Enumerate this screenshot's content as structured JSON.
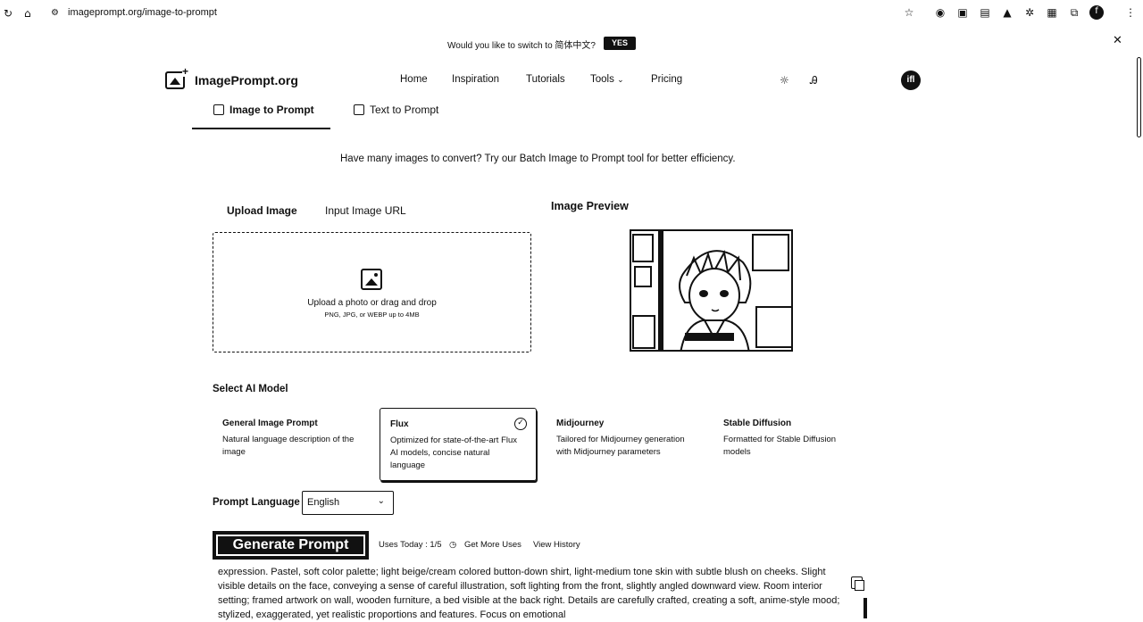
{
  "browser": {
    "url": "imageprompt.org/image-to-prompt",
    "icons": [
      "reload-icon",
      "home-icon",
      "site-info-icon",
      "bookmark-star-icon",
      "extension-icon",
      "extension-icon",
      "extension-icon",
      "extension-icon",
      "extension-icon",
      "extension-icon",
      "puzzle-icon",
      "profile-icon",
      "menu-icon"
    ]
  },
  "banner": {
    "text": "Would you like to switch to 简体中文?",
    "yes_label": "YES"
  },
  "header": {
    "logo_text": "ImagePrompt.org",
    "nav": [
      "Home",
      "Inspiration",
      "Tutorials",
      "Tools",
      "Pricing"
    ],
    "avatar_text": "ifl"
  },
  "tabs": {
    "image_to_prompt": "Image to Prompt",
    "text_to_prompt": "Text to Prompt"
  },
  "batch_text": "Have many images to convert? Try our Batch Image to Prompt tool for better efficiency.",
  "upload": {
    "tab_upload": "Upload Image",
    "tab_url": "Input Image URL",
    "drop_main": "Upload a photo or drag and drop",
    "drop_sub": "PNG, JPG, or WEBP up to 4MB"
  },
  "preview": {
    "title": "Image Preview"
  },
  "models": {
    "section_title": "Select AI Model",
    "items": [
      {
        "title": "General Image Prompt",
        "desc": "Natural language description of the image"
      },
      {
        "title": "Flux",
        "desc": "Optimized for state-of-the-art Flux AI models, concise natural language"
      },
      {
        "title": "Midjourney",
        "desc": "Tailored for Midjourney generation with Midjourney parameters"
      },
      {
        "title": "Stable Diffusion",
        "desc": "Formatted for Stable Diffusion models"
      }
    ],
    "selected": "Flux"
  },
  "prompt_language": {
    "label": "Prompt Language",
    "value": "English"
  },
  "generate": {
    "label": "Generate Prompt",
    "uses_today": "Uses Today : 1/5",
    "more_uses": "Get More Uses",
    "history": "View History"
  },
  "result_text": "expression. Pastel, soft color palette; light beige/cream colored button-down shirt, light-medium tone skin with subtle blush on cheeks. Slight visible details on the face, conveying a sense of careful illustration, soft lighting from the front, slightly angled downward view. Room interior setting; framed artwork on wall, wooden furniture, a bed visible at the back right. Details are carefully crafted, creating a soft, anime-style mood; stylized, exaggerated, yet realistic proportions and features. Focus on emotional"
}
